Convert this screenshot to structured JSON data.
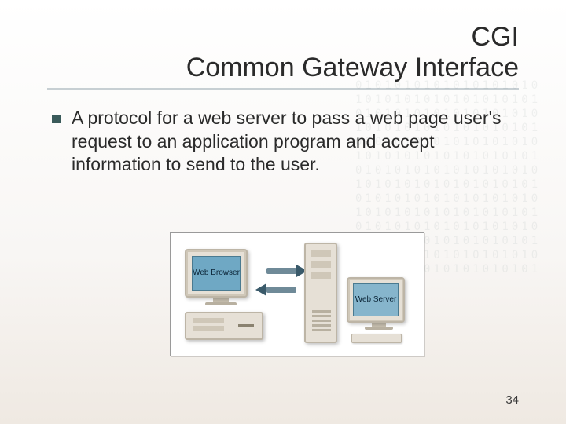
{
  "title": {
    "line1": "CGI",
    "line2": "Common Gateway Interface"
  },
  "bullet": {
    "text": "A protocol for a web server to pass a web page user's request to an application program and accept information to send to the user."
  },
  "figure": {
    "client_label": "Web Browser",
    "server_label": "Web Server"
  },
  "page_number": "34",
  "bg_binary": "0101010101010101010\n1010101010101010101\n0101010101010101010\n1010101010101010101\n0101010101010101010\n1010101010101010101\n0101010101010101010\n1010101010101010101\n0101010101010101010\n1010101010101010101\n0101010101010101010\n1010101010101010101\n0101010101010101010\n1010101010101010101"
}
